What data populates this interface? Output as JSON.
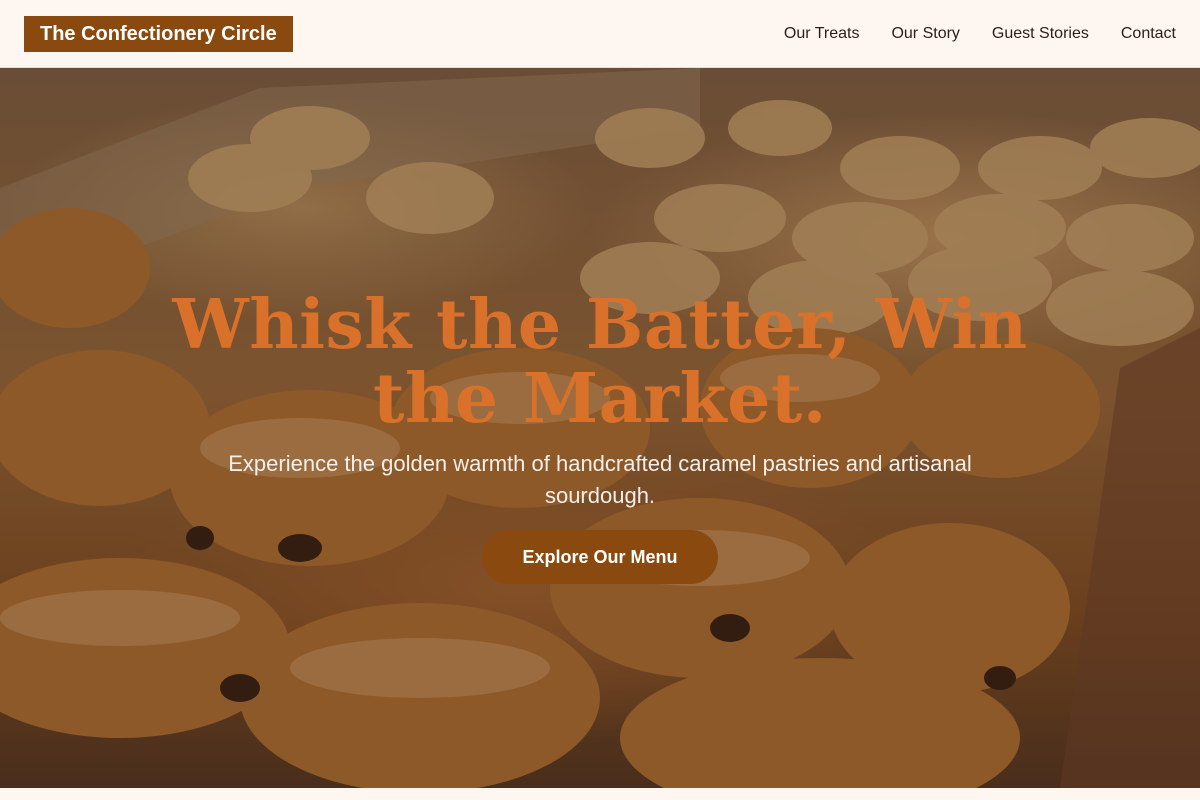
{
  "header": {
    "brand": "The Confectionery Circle",
    "nav": [
      {
        "label": "Our Treats"
      },
      {
        "label": "Our Story"
      },
      {
        "label": "Guest Stories"
      },
      {
        "label": "Contact"
      }
    ]
  },
  "hero": {
    "headline": "Whisk the Batter, Win the Market.",
    "subheadline": "Experience the golden warmth of handcrafted caramel pastries and artisanal sourdough.",
    "cta_label": "Explore Our Menu",
    "background_image": "bakery-pastry-display-photo"
  },
  "colors": {
    "brand": "#8a4a0f",
    "headline": "#d9712a",
    "header_bg": "#fdf6f1",
    "nav_text": "#2a1e17"
  }
}
